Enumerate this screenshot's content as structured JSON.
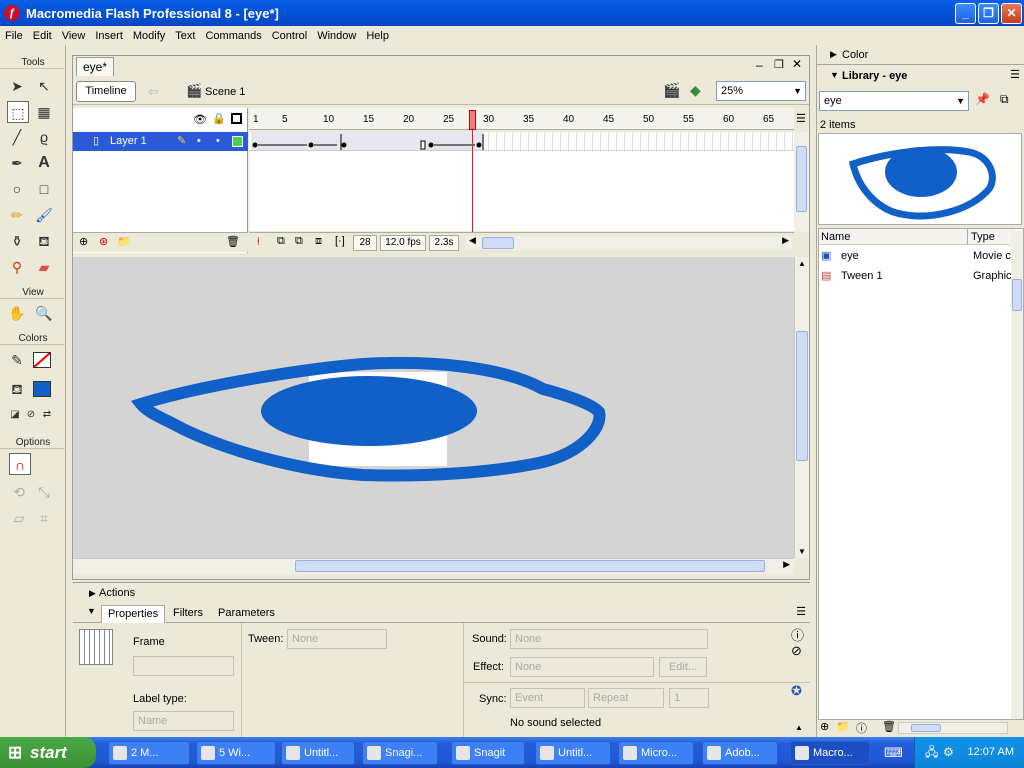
{
  "window": {
    "title": "Macromedia Flash Professional 8 - [eye*]"
  },
  "menu": [
    "File",
    "Edit",
    "View",
    "Insert",
    "Modify",
    "Text",
    "Commands",
    "Control",
    "Window",
    "Help"
  ],
  "tools": {
    "section_tools": "Tools",
    "section_view": "View",
    "section_colors": "Colors",
    "section_options": "Options"
  },
  "document": {
    "tab": "eye*",
    "timeline_button": "Timeline",
    "scene": "Scene 1",
    "zoom": "25%",
    "layer_name": "Layer 1",
    "ruler": [
      "1",
      "5",
      "10",
      "15",
      "20",
      "25",
      "30",
      "35",
      "40",
      "45",
      "50",
      "55",
      "60",
      "65"
    ],
    "current_frame": "28",
    "fps": "12.0 fps",
    "elapsed": "2.3s"
  },
  "panels": {
    "actions": "Actions",
    "properties_tabs": [
      "Properties",
      "Filters",
      "Parameters"
    ]
  },
  "properties": {
    "frame_label": "Frame",
    "label_type": "Label type:",
    "label_type_value": "Name",
    "tween_label": "Tween:",
    "tween_value": "None",
    "sound_label": "Sound:",
    "sound_value": "None",
    "effect_label": "Effect:",
    "effect_value": "None",
    "edit_button": "Edit...",
    "sync_label": "Sync:",
    "sync_value": "Event",
    "repeat_value": "Repeat",
    "repeat_count": "1",
    "sound_status": "No sound selected"
  },
  "right_panel": {
    "color_title": "Color",
    "library_title": "Library - eye",
    "library_dropdown": "eye",
    "item_count": "2 items",
    "col_name": "Name",
    "col_type": "Type",
    "items": [
      {
        "name": "eye",
        "type": "Movie c"
      },
      {
        "name": "Tween 1",
        "type": "Graphic"
      }
    ]
  },
  "taskbar": {
    "start": "start",
    "tasks": [
      "2 M...",
      "5 Wi...",
      "Untitl...",
      "Snagi...",
      "Snagit",
      "Untitl...",
      "Micro...",
      "Adob...",
      "Macro..."
    ],
    "clock": "12:07 AM"
  },
  "colors": {
    "eye_blue": "#1060c8",
    "layer_selected": "#2a5ad5",
    "playhead": "#e02020"
  }
}
